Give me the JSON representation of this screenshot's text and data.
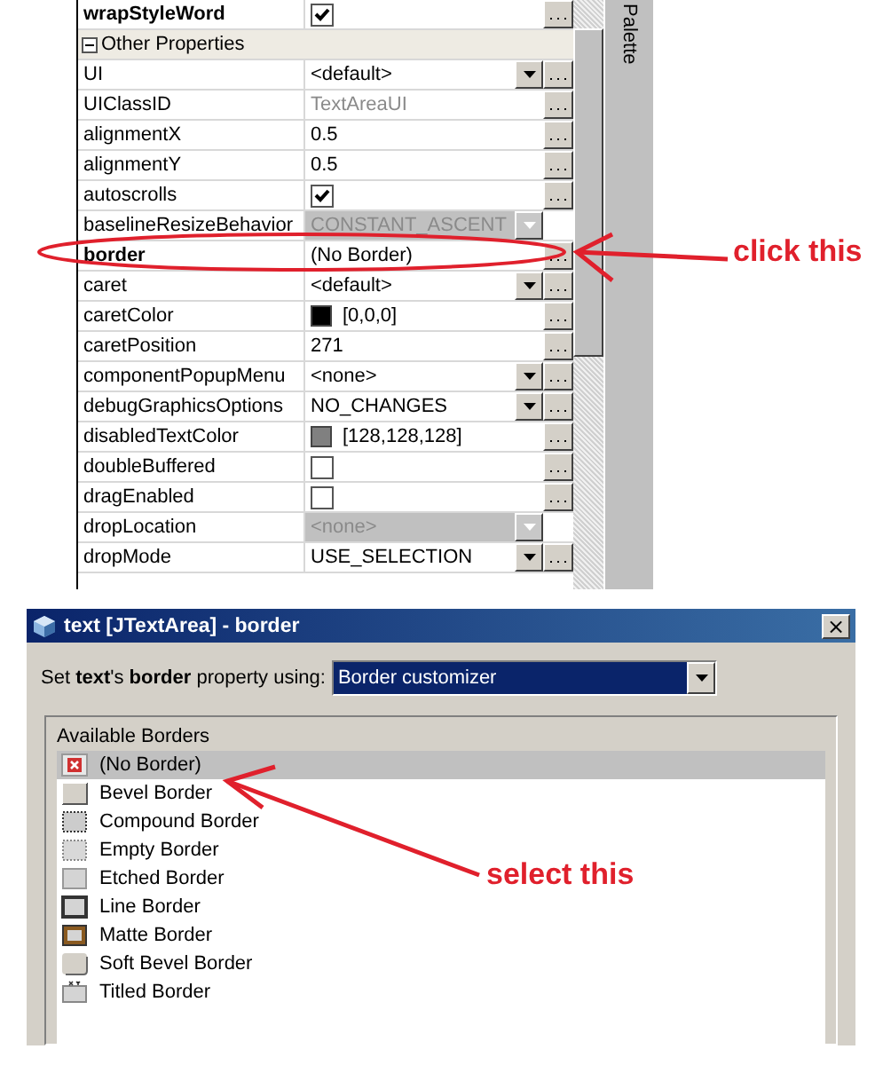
{
  "property_sheet": {
    "rows": [
      {
        "kind": "check",
        "name": "wrapStyleWord",
        "bold": true,
        "checked": true
      },
      {
        "kind": "category",
        "name": "Other Properties",
        "expanded": true
      },
      {
        "kind": "combo",
        "name": "UI",
        "value": "<default>"
      },
      {
        "kind": "readonly",
        "name": "UIClassID",
        "value": "TextAreaUI"
      },
      {
        "kind": "text",
        "name": "alignmentX",
        "value": "0.5"
      },
      {
        "kind": "text",
        "name": "alignmentY",
        "value": "0.5"
      },
      {
        "kind": "check",
        "name": "autoscrolls",
        "checked": true
      },
      {
        "kind": "disabled",
        "name": "baselineResizeBehavior",
        "value": "CONSTANT_ASCENT"
      },
      {
        "kind": "text",
        "name": "border",
        "bold": true,
        "value": "(No Border)"
      },
      {
        "kind": "combo",
        "name": "caret",
        "value": "<default>"
      },
      {
        "kind": "color",
        "name": "caretColor",
        "color": "#000000",
        "value": "[0,0,0]"
      },
      {
        "kind": "text",
        "name": "caretPosition",
        "value": "271"
      },
      {
        "kind": "combo",
        "name": "componentPopupMenu",
        "value": "<none>"
      },
      {
        "kind": "combo",
        "name": "debugGraphicsOptions",
        "value": "NO_CHANGES"
      },
      {
        "kind": "color",
        "name": "disabledTextColor",
        "color": "#808080",
        "value": "[128,128,128]"
      },
      {
        "kind": "check",
        "name": "doubleBuffered",
        "checked": false
      },
      {
        "kind": "check",
        "name": "dragEnabled",
        "checked": false
      },
      {
        "kind": "disabled",
        "name": "dropLocation",
        "value": "<none>"
      },
      {
        "kind": "combo",
        "name": "dropMode",
        "value": "USE_SELECTION"
      }
    ]
  },
  "palette": {
    "label": "Palette"
  },
  "annotations": {
    "click": "click this",
    "select": "select this"
  },
  "dialog": {
    "title": "text [JTextArea] - border",
    "close": "×",
    "prompt": "Set **text**'s **border** property using:",
    "customizer": "Border customizer",
    "group_title": "Available Borders",
    "borders": [
      {
        "kind": "none",
        "label": "(No Border)",
        "selected": true
      },
      {
        "kind": "bevel",
        "label": "Bevel Border",
        "selected": false
      },
      {
        "kind": "compound",
        "label": "Compound Border",
        "selected": false
      },
      {
        "kind": "empty",
        "label": "Empty Border",
        "selected": false
      },
      {
        "kind": "etched",
        "label": "Etched Border",
        "selected": false
      },
      {
        "kind": "line",
        "label": "Line Border",
        "selected": false
      },
      {
        "kind": "matte",
        "label": "Matte Border",
        "selected": false
      },
      {
        "kind": "softbevel",
        "label": "Soft Bevel Border",
        "selected": false
      },
      {
        "kind": "titled",
        "label": "Titled Border",
        "selected": false
      }
    ]
  }
}
